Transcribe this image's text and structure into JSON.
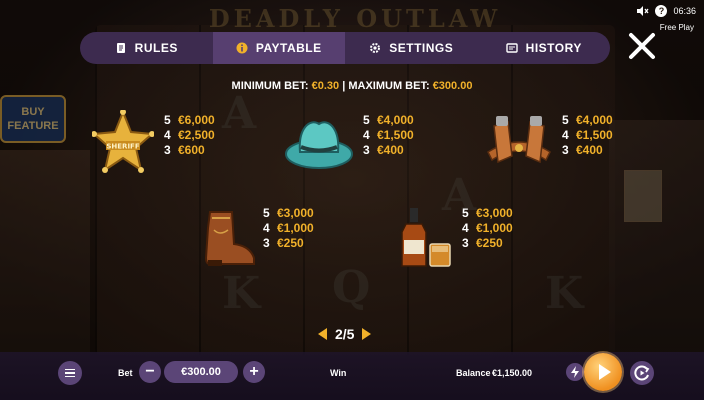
{
  "status": {
    "time": "06:36",
    "mode": "Free Play"
  },
  "background": {
    "title_text": "DEADLY OUTLAW",
    "buy_feature": "BUY FEATURE"
  },
  "tabs": [
    {
      "label": "RULES",
      "icon": "document-icon",
      "active": false
    },
    {
      "label": "PAYTABLE",
      "icon": "info-icon",
      "active": true
    },
    {
      "label": "SETTINGS",
      "icon": "gear-icon",
      "active": false
    },
    {
      "label": "HISTORY",
      "icon": "history-icon",
      "active": false
    }
  ],
  "limits": {
    "min_label": "MINIMUM BET:",
    "min_value": "€0.30",
    "separator": "|",
    "max_label": "MAXIMUM BET:",
    "max_value": "€300.00"
  },
  "paytable": [
    {
      "symbol": "sheriff-badge-icon",
      "badge_text": "SHERIFF",
      "pays": [
        {
          "count": "5",
          "value": "€6,000"
        },
        {
          "count": "4",
          "value": "€2,500"
        },
        {
          "count": "3",
          "value": "€600"
        }
      ]
    },
    {
      "symbol": "cowboy-hat-icon",
      "pays": [
        {
          "count": "5",
          "value": "€4,000"
        },
        {
          "count": "4",
          "value": "€1,500"
        },
        {
          "count": "3",
          "value": "€400"
        }
      ]
    },
    {
      "symbol": "gun-holster-icon",
      "pays": [
        {
          "count": "5",
          "value": "€4,000"
        },
        {
          "count": "4",
          "value": "€1,500"
        },
        {
          "count": "3",
          "value": "€400"
        }
      ]
    },
    {
      "symbol": "cowboy-boot-icon",
      "pays": [
        {
          "count": "5",
          "value": "€3,000"
        },
        {
          "count": "4",
          "value": "€1,000"
        },
        {
          "count": "3",
          "value": "€250"
        }
      ]
    },
    {
      "symbol": "whiskey-bottle-icon",
      "pays": [
        {
          "count": "5",
          "value": "€3,000"
        },
        {
          "count": "4",
          "value": "€1,000"
        },
        {
          "count": "3",
          "value": "€250"
        }
      ]
    }
  ],
  "pager": {
    "text": "2/5"
  },
  "bottom": {
    "bet_label": "Bet",
    "bet_value": "€300.00",
    "minus": "−",
    "plus": "+",
    "win_label": "Win",
    "balance_label": "Balance",
    "balance_value": "€1,150.00"
  },
  "colors": {
    "accent": "#f1b12a",
    "tab_bar": "#3d2b4f",
    "tab_active": "#573f70",
    "button": "#5b4577"
  }
}
